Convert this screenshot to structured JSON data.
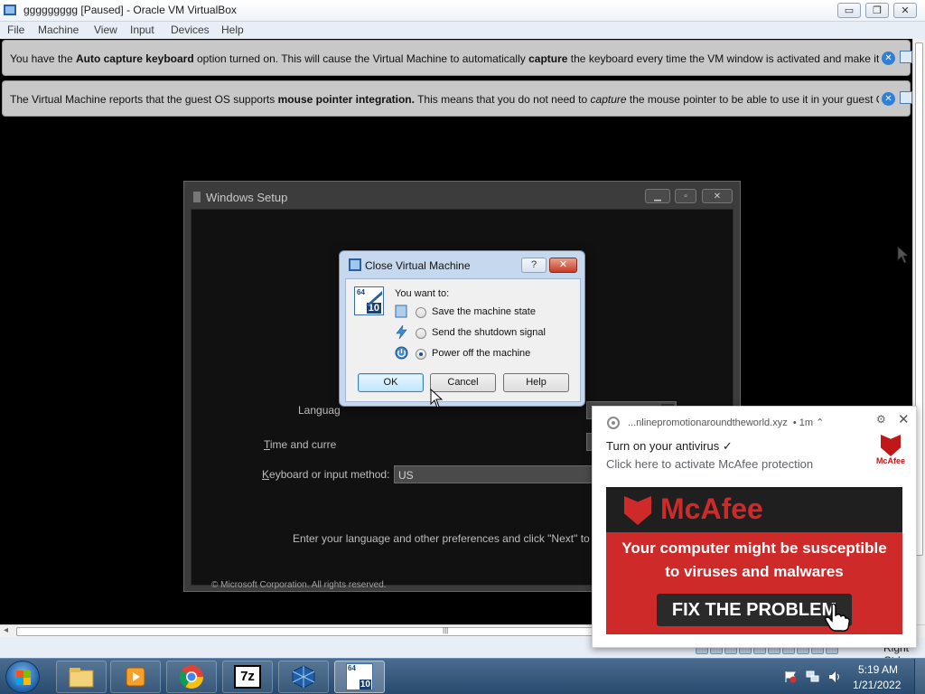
{
  "window": {
    "title": "ggggggggg [Paused] - Oracle VM VirtualBox",
    "minimize": "▭",
    "maximize": "❐",
    "close": "✕"
  },
  "menu": [
    "File",
    "Machine",
    "View",
    "Input",
    "Devices",
    "Help"
  ],
  "notifications": [
    {
      "prefix": "You have the ",
      "bold1": "Auto capture keyboard",
      "middle": " option turned on. This will cause the Virtual Machine to automatically ",
      "bold2": "capture",
      "suffix": " the keyboard every time the VM window is activated and make it unavailable to"
    },
    {
      "prefix": "The Virtual Machine reports that the guest OS supports ",
      "bold1": "mouse pointer integration.",
      "middle": " This means that you do not need to ",
      "italic": "capture",
      "suffix": " the mouse pointer to be able to use it in your guest OS -- all mouse"
    }
  ],
  "setup": {
    "title": "Windows Setup",
    "language_label": "Languag",
    "time_label_pre": "T",
    "time_label": "ime and curre",
    "keyboard_label": "K",
    "keyboard_label_rest": "eyboard or input method:",
    "keyboard_value": "US",
    "hint": "Enter your language and other preferences and click \"Next\" to c",
    "copyright": "© Microsoft Corporation. All rights reserved."
  },
  "dialog": {
    "title": "Close Virtual Machine",
    "help_glyph": "?",
    "close_glyph": "✕",
    "prompt": "You want to:",
    "options": [
      {
        "label": "Save the machine state",
        "checked": false
      },
      {
        "label": "Send the shutdown signal",
        "checked": false
      },
      {
        "label": "Power off the machine",
        "checked": true
      }
    ],
    "ok": "OK",
    "cancel": "Cancel",
    "help": "Help",
    "logo_top": "64",
    "logo_bottom": "10"
  },
  "chrome_notification": {
    "origin": "...nlinepromotionaroundtheworld.xyz",
    "age": "• 1m",
    "chevron": "⌃",
    "title": "Turn on your antivirus ✓",
    "message": "Click here to activate McAfee protection",
    "brand_small": "McAfee",
    "banner_brand": "McAfee",
    "banner_line1": "Your computer might be susceptible",
    "banner_line2": "to viruses and malwares",
    "banner_button": "FIX THE PROBLEM"
  },
  "statusbar": {
    "host_key": "Right Ctrl"
  },
  "taskbar": {
    "apps": [
      "explorer-icon",
      "media-player-icon",
      "chrome-icon",
      "7zip-icon",
      "virtualbox-icon",
      "vm-win10-icon"
    ],
    "time": "5:19 AM",
    "date": "1/21/2022",
    "sevenzip_label": "7z",
    "vm_top": "64",
    "vm_bottom": "10"
  }
}
